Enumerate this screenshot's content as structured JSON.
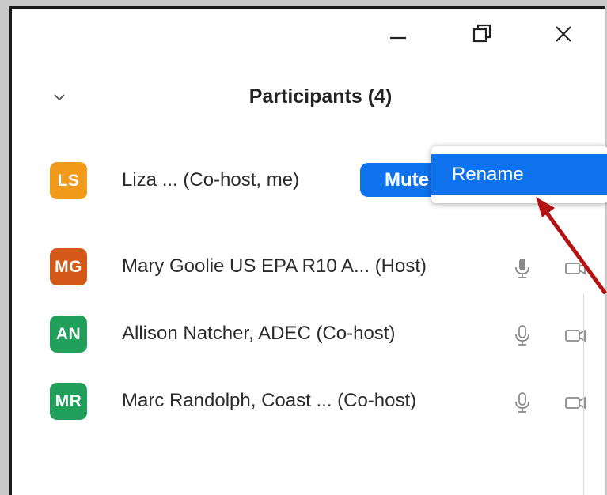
{
  "window": {
    "controls": {
      "minimize": "minimize-icon",
      "restore": "restore-icon",
      "close": "close-icon"
    }
  },
  "panel": {
    "title": "Participants (4)",
    "chevron": "chevron-down-icon"
  },
  "participants": [
    {
      "initials": "LS",
      "name": "Liza ...  (Co-host, me)",
      "avatar_color": "#f29a1a",
      "mute_label": "Mute",
      "mic": "mic-icon",
      "video": "video-off-icon"
    },
    {
      "initials": "MG",
      "name": "Mary Goolie US EPA R10 A... (Host)",
      "avatar_color": "#d45817",
      "mic": "mic-icon",
      "video": "video-off-icon"
    },
    {
      "initials": "AN",
      "name": "Allison Natcher, ADEC (Co-host)",
      "avatar_color": "#20a05a",
      "mic": "mic-icon",
      "video": "video-off-icon"
    },
    {
      "initials": "MR",
      "name": "Marc Randolph, Coast ...  (Co-host)",
      "avatar_color": "#20a05a",
      "mic": "mic-icon",
      "video": "video-off-icon"
    }
  ],
  "context_menu": {
    "items": [
      {
        "label": "Rename"
      }
    ]
  },
  "annotation": {
    "arrow_color": "#b51212"
  },
  "colors": {
    "accent": "#0e72ed",
    "text": "#2b2b2b"
  }
}
